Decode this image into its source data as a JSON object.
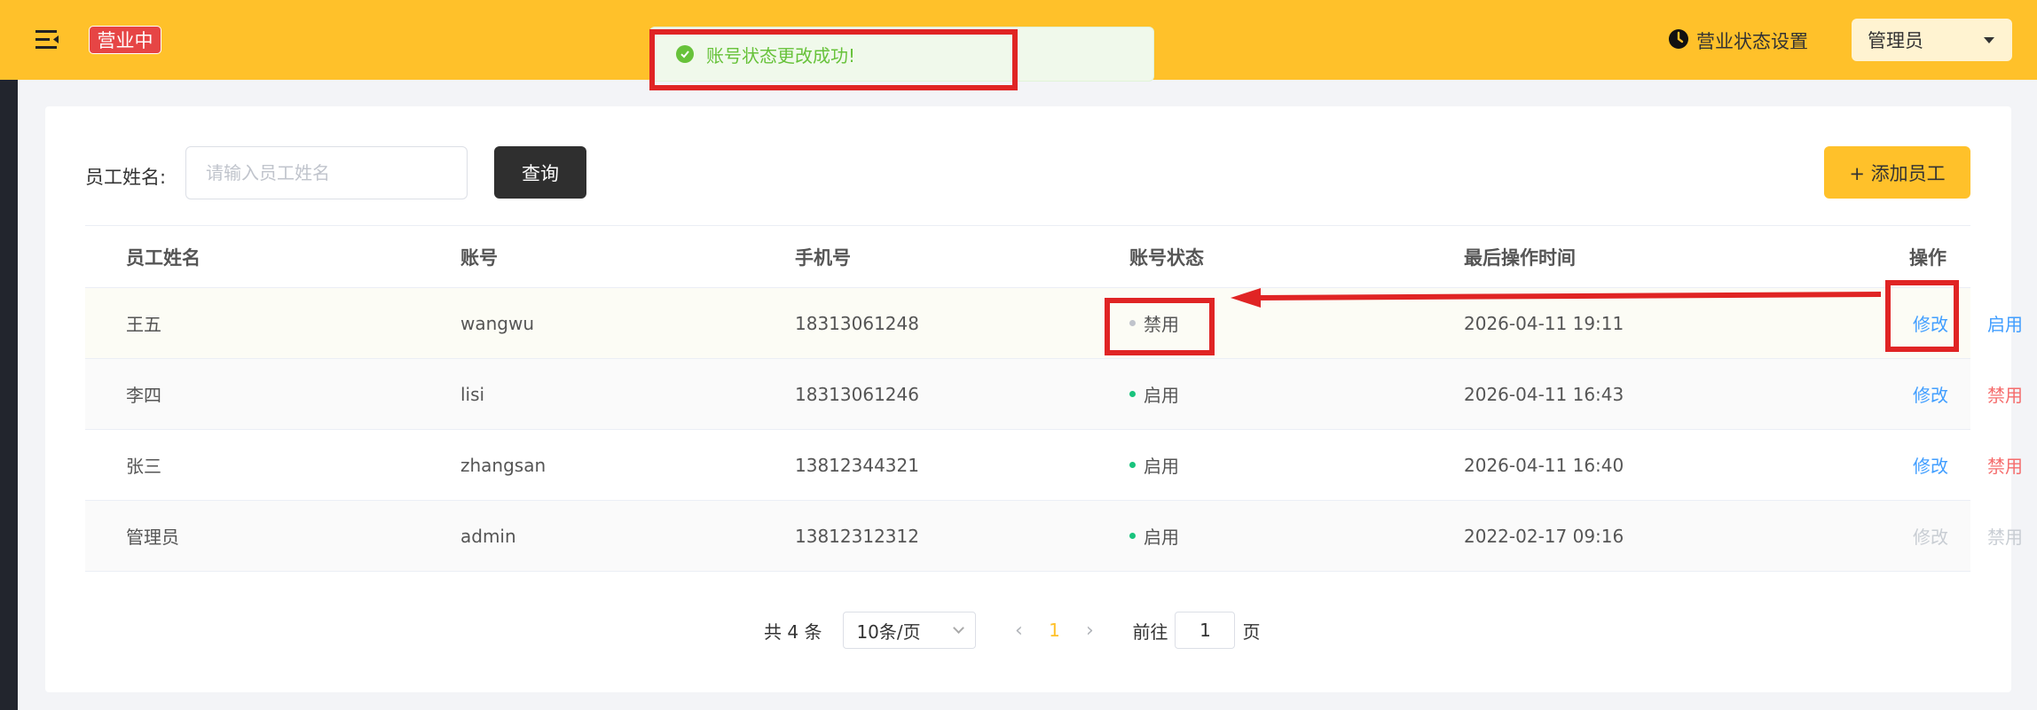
{
  "header": {
    "status_badge": "营业中",
    "biz_status_label": "营业状态设置",
    "user_menu": "管理员"
  },
  "toast": {
    "message": "账号状态更改成功!"
  },
  "search": {
    "label": "员工姓名:",
    "placeholder": "请输入员工姓名",
    "query_label": "查询"
  },
  "add_label": "+ 添加员工",
  "table": {
    "headers": [
      "员工姓名",
      "账号",
      "手机号",
      "账号状态",
      "最后操作时间",
      "操作"
    ],
    "rows": [
      {
        "name": "王五",
        "account": "wangwu",
        "phone": "18313061248",
        "status": "禁用",
        "time": "2026-04-11 19:11",
        "edit": "修改",
        "action": "启用"
      },
      {
        "name": "李四",
        "account": "lisi",
        "phone": "18313061246",
        "status": "启用",
        "time": "2026-04-11 16:43",
        "edit": "修改",
        "action": "禁用"
      },
      {
        "name": "张三",
        "account": "zhangsan",
        "phone": "13812344321",
        "status": "启用",
        "time": "2026-04-11 16:40",
        "edit": "修改",
        "action": "禁用"
      },
      {
        "name": "管理员",
        "account": "admin",
        "phone": "13812312312",
        "status": "启用",
        "time": "2022-02-17 09:16",
        "edit": "修改",
        "action": "禁用"
      }
    ]
  },
  "pagination": {
    "total": "共 4 条",
    "page_size": "10条/页",
    "current_page": "1",
    "goto_label": "前往",
    "goto_value": "1",
    "page_suffix": "页"
  },
  "colors": {
    "header": "#ffc12a",
    "badge": "#e64545",
    "success": "#67c23a",
    "link": "#419eff",
    "danger": "#f56c6c",
    "status_on": "#19c37d",
    "status_off": "#c0c4cc",
    "annotation": "#e02424"
  },
  "icons": {
    "menu": "menu-fold-icon",
    "clock": "clock-icon",
    "toast": "check-circle-icon"
  }
}
